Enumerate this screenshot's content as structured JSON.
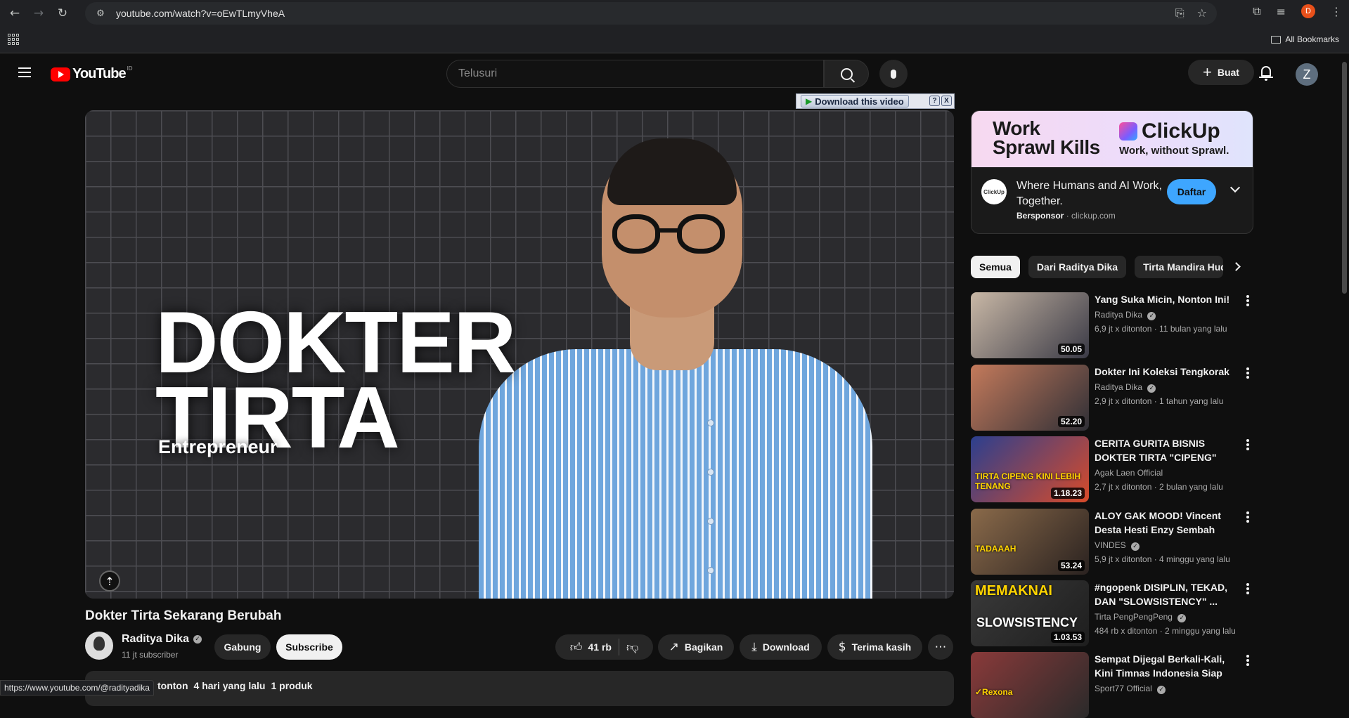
{
  "browser": {
    "url": "youtube.com/watch?v=oEwTLmyVheA",
    "profile_initial": "D",
    "all_bookmarks": "All Bookmarks",
    "status_url": "https://www.youtube.com/@radityadika"
  },
  "header": {
    "logo_text": "YouTube",
    "logo_country": "ID",
    "search_placeholder": "Telusuri",
    "create_label": "Buat",
    "account_initial": "Z"
  },
  "player": {
    "thumbnail_title_line1": "DOKTER",
    "thumbnail_title_line2": "TIRTA",
    "thumbnail_subtitle": "Entrepreneur",
    "download_bar_label": "Download this video",
    "download_help": "?",
    "download_close": "X"
  },
  "video": {
    "title": "Dokter Tirta Sekarang Berubah",
    "channel": "Raditya Dika",
    "subscribers": "11 jt subscriber",
    "join_label": "Gabung",
    "subscribe_label": "Subscribe",
    "likes": "41 rb",
    "share_label": "Bagikan",
    "download_label": "Download",
    "thanks_label": "Terima kasih",
    "desc_views": "tonton",
    "desc_date": "4 hari yang lalu",
    "desc_products": "1 produk"
  },
  "ad": {
    "headline_line1": "Work",
    "headline_line2": "Sprawl Kills",
    "brand": "ClickUp",
    "brand_tagline": "Work, without Sprawl.",
    "icon_label": "ClickUp",
    "title": "Where Humans and AI Work, Together.",
    "sponsored": "Bersponsor",
    "domain": "clickup.com",
    "cta": "Daftar"
  },
  "chips": [
    "Semua",
    "Dari Raditya Dika",
    "Tirta Mandira Hudhi"
  ],
  "recommendations": [
    {
      "title": "Yang Suka Micin, Nonton Ini!",
      "channel": "Raditya Dika",
      "verified": true,
      "stats": "6,9 jt x ditonton · 11 bulan yang lalu",
      "duration": "50.05",
      "thumb_colors": [
        "#c9b8a6",
        "#3a3a46"
      ]
    },
    {
      "title": "Dokter Ini Koleksi Tengkorak",
      "channel": "Raditya Dika",
      "verified": true,
      "stats": "2,9 jt x ditonton · 1 tahun yang lalu",
      "duration": "52.20",
      "thumb_colors": [
        "#c47a5b",
        "#2f2f36"
      ]
    },
    {
      "title": "CERITA GURITA BISNIS DOKTER TIRTA \"CIPENG\" SEJ...",
      "channel": "Agak Laen Official",
      "verified": false,
      "stats": "2,7 jt x ditonton · 2 bulan yang lalu",
      "duration": "1.18.23",
      "thumb_colors": [
        "#2b3f8f",
        "#d84b2a"
      ],
      "thumb_text": "TIRTA CIPENG KINI LEBIH TENANG"
    },
    {
      "title": "ALOY GAK MOOD! Vincent Desta Hesti Enzy Sembah Aloy...",
      "channel": "VINDES",
      "verified": true,
      "stats": "5,9 jt x ditonton · 4 minggu yang lalu",
      "duration": "53.24",
      "thumb_colors": [
        "#8a6a4a",
        "#2a2220"
      ],
      "thumb_text": "TADAAAH"
    },
    {
      "title": "#ngopenk DISIPLIN, TEKAD, DAN \"SLOWSISTENCY\" ...",
      "channel": "Tirta PengPengPeng",
      "verified": true,
      "stats": "484 rb x ditonton · 2 minggu yang lalu",
      "duration": "1.03.53",
      "thumb_colors": [
        "#3a3a3a",
        "#1e1e1e"
      ],
      "thumb_text": "MEMAKNAI",
      "thumb_text2": "SLOWSISTENCY"
    },
    {
      "title": "Sempat Dijegal Berkali-Kali, Kini Timnas Indonesia Siap Hadapi...",
      "channel": "Sport77 Official",
      "verified": true,
      "stats": "",
      "duration": "",
      "thumb_colors": [
        "#8a3a3a",
        "#2a2a2a"
      ],
      "thumb_text": "✓Rexona"
    }
  ]
}
